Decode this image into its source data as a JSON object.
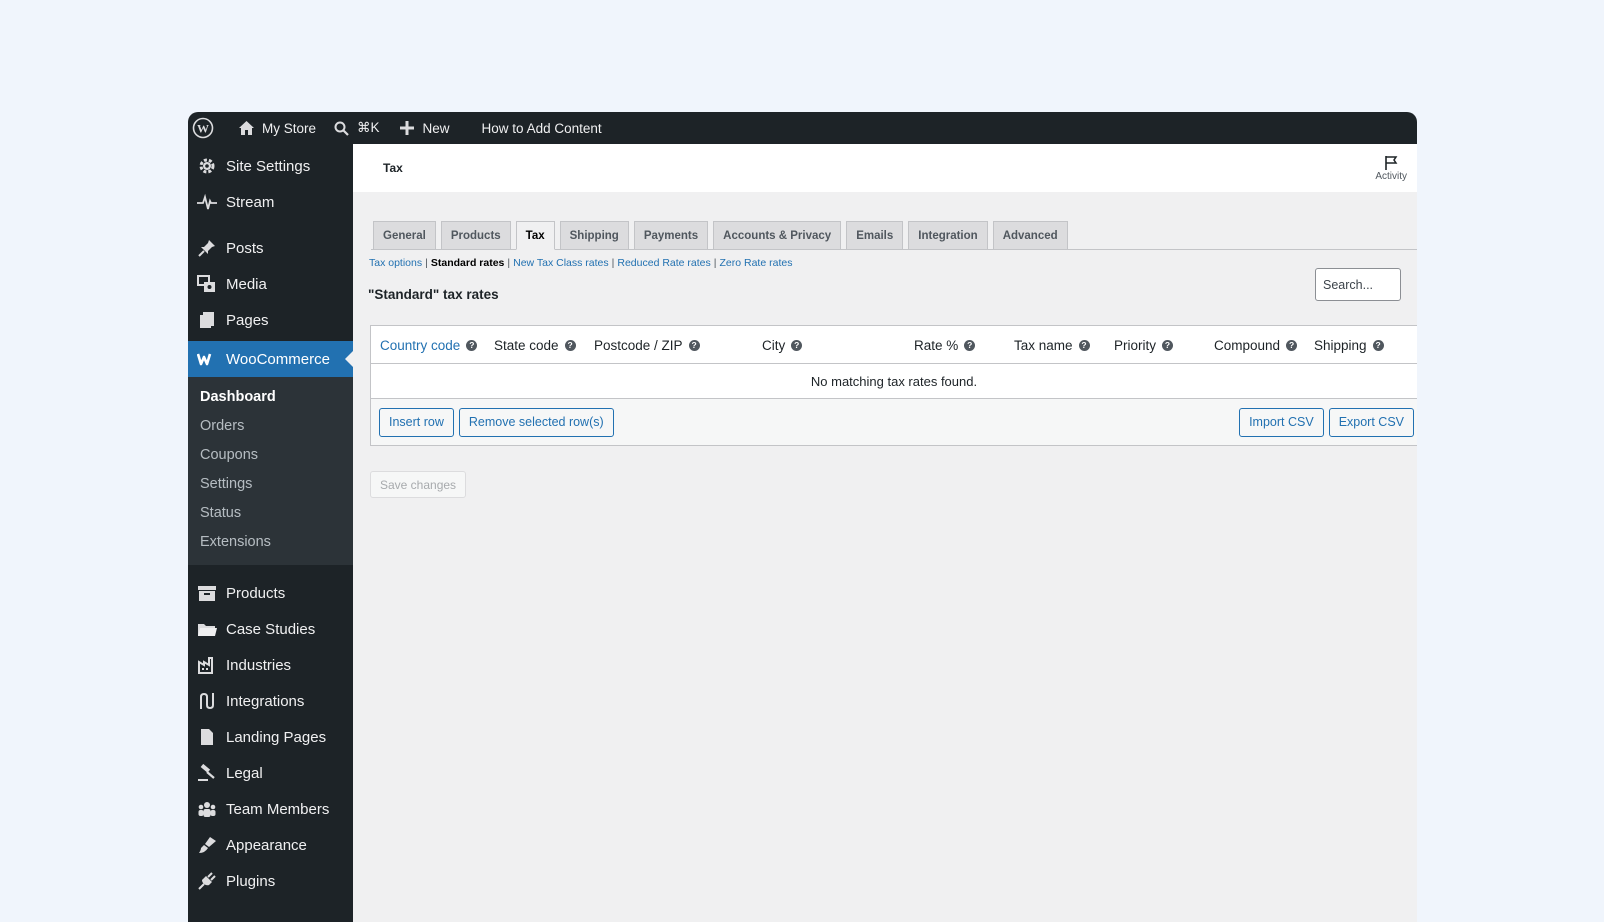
{
  "colors": {
    "accent": "#2271b1",
    "adminbar": "#1d2327",
    "background": "#f0f5fc"
  },
  "adminbar": {
    "site_name": "My Store",
    "search_shortcut": "⌘K",
    "new_label": "New",
    "help_link": "How to Add Content"
  },
  "sidebar": {
    "top_items": [
      {
        "label": "Site Settings",
        "icon": "gear-icon"
      },
      {
        "label": "Stream",
        "icon": "pulse-icon"
      },
      {
        "label": "Posts",
        "icon": "pin-icon"
      },
      {
        "label": "Media",
        "icon": "media-icon"
      },
      {
        "label": "Pages",
        "icon": "pages-icon"
      },
      {
        "label": "WooCommerce",
        "icon": "woocommerce-icon"
      }
    ],
    "woo_submenu": [
      "Dashboard",
      "Orders",
      "Coupons",
      "Settings",
      "Status",
      "Extensions"
    ],
    "bottom_items": [
      {
        "label": "Products",
        "icon": "archive-icon"
      },
      {
        "label": "Case Studies",
        "icon": "folder-icon"
      },
      {
        "label": "Industries",
        "icon": "factory-icon"
      },
      {
        "label": "Integrations",
        "icon": "integrations-icon"
      },
      {
        "label": "Landing Pages",
        "icon": "document-icon"
      },
      {
        "label": "Legal",
        "icon": "gavel-icon"
      },
      {
        "label": "Team Members",
        "icon": "groups-icon"
      },
      {
        "label": "Appearance",
        "icon": "brush-icon"
      },
      {
        "label": "Plugins",
        "icon": "plug-icon"
      }
    ]
  },
  "header": {
    "title": "Tax",
    "activity_label": "Activity"
  },
  "tabs": [
    "General",
    "Products",
    "Tax",
    "Shipping",
    "Payments",
    "Accounts & Privacy",
    "Emails",
    "Integration",
    "Advanced"
  ],
  "active_tab": "Tax",
  "subsubsub": {
    "tax_options": "Tax options",
    "standard_rates": "Standard rates",
    "new_tax_class": "New Tax Class rates",
    "reduced_rate": "Reduced Rate rates",
    "zero_rate": "Zero Rate rates"
  },
  "section_title": "\"Standard\" tax rates",
  "search": {
    "placeholder": "Search..."
  },
  "table": {
    "columns": [
      "Country code",
      "State code",
      "Postcode / ZIP",
      "City",
      "Rate %",
      "Tax name",
      "Priority",
      "Compound",
      "Shipping"
    ],
    "empty_message": "No matching tax rates found.",
    "insert_row": "Insert row",
    "remove_rows": "Remove selected row(s)",
    "import_csv": "Import CSV",
    "export_csv": "Export CSV"
  },
  "save_button": "Save changes"
}
